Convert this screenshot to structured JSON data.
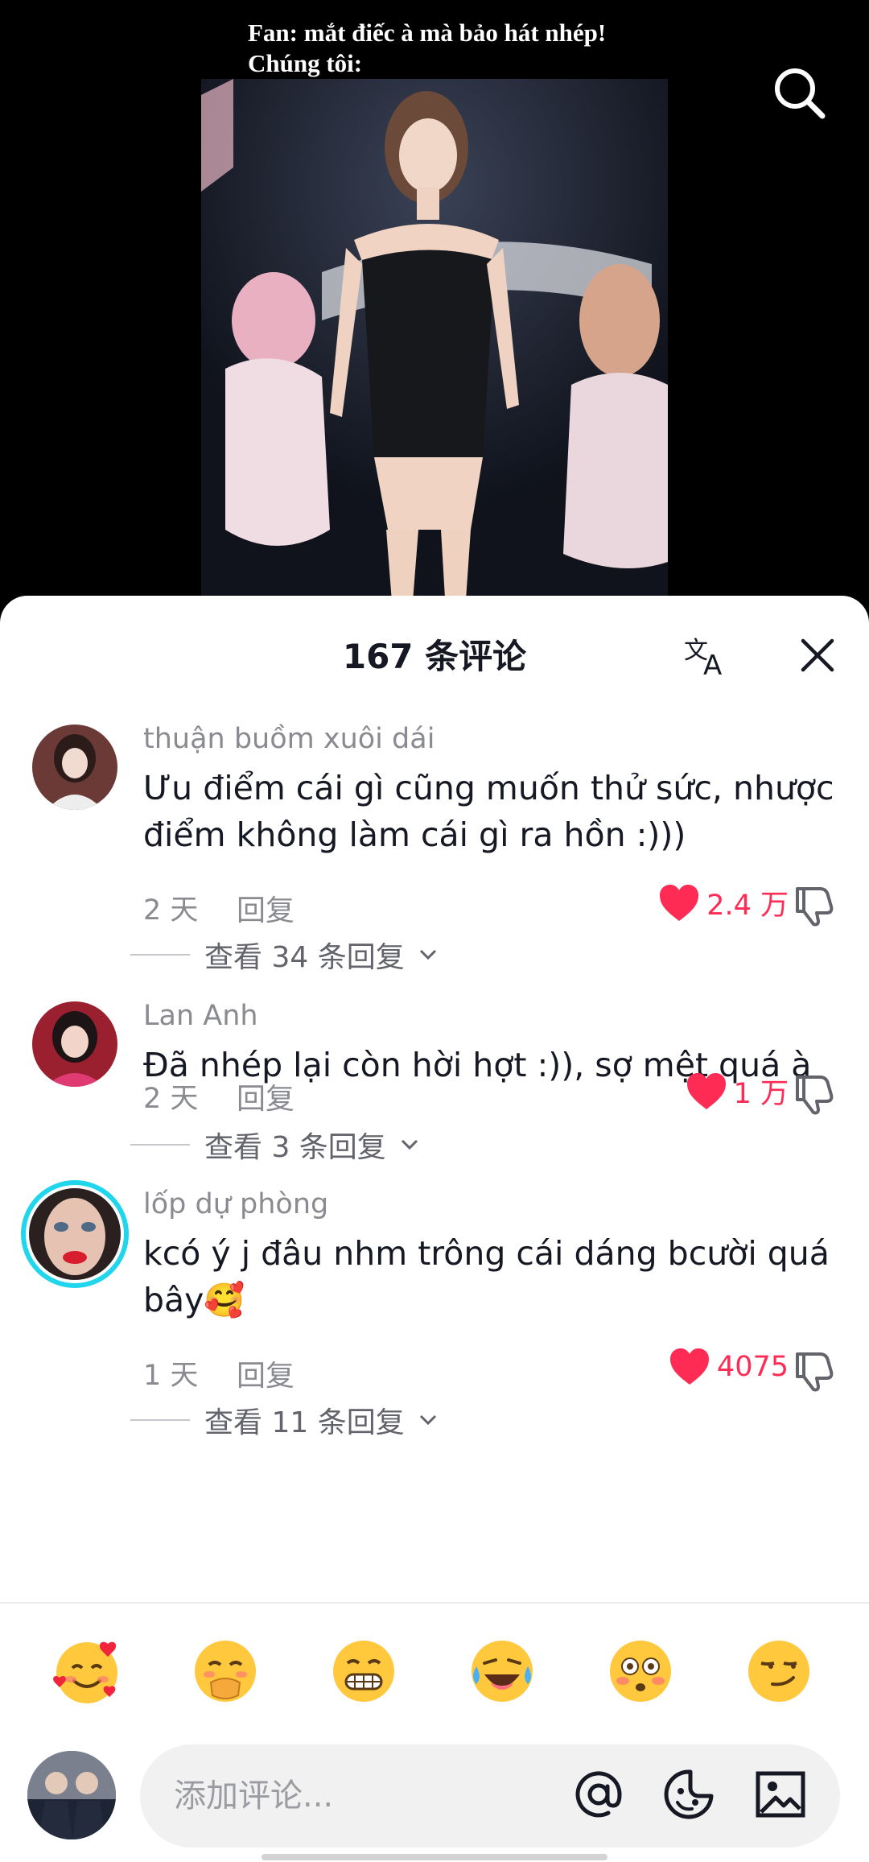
{
  "video": {
    "caption_line1": "Fan: mắt điếc à mà bảo hát nhép!",
    "caption_line2": "Chúng tôi:",
    "search_icon": "search-icon"
  },
  "sheet": {
    "title": "167 条评论",
    "translate_icon": "translate-icon",
    "close_icon": "close-icon"
  },
  "comments": [
    {
      "username": "thuận buồm xuôi dái",
      "text": "Ưu điểm cái gì cũng muốn thử sức, nhược điểm không làm cái gì ra hồn :)))",
      "time": "2 天",
      "reply_label": "回复",
      "likes": "2.4 万",
      "view_replies": "查看 34 条回复"
    },
    {
      "username": "Lan Anh",
      "text": "Đã nhép lại còn hời hợt :)), sợ mệt quá à",
      "time": "2 天",
      "reply_label": "回复",
      "likes": "1 万",
      "view_replies": "查看 3 条回复"
    },
    {
      "username": "lốp dự phòng",
      "text": "kcó ý j đâu nhm trông cái dáng bcười quá bây🥰",
      "time": "1 天",
      "reply_label": "回复",
      "likes": "4075",
      "view_replies": "查看 11 条回复"
    }
  ],
  "quick_emojis": [
    "smiling-face-with-hearts",
    "face-with-hand-over-mouth",
    "grinning-teeth",
    "tears-of-joy",
    "flushed-face",
    "smirking-face"
  ],
  "input": {
    "placeholder": "添加评论...",
    "icons": [
      "mention-icon",
      "emoji-icon",
      "image-icon"
    ]
  },
  "colors": {
    "like_red": "#fe2c55",
    "verified_ring": "#20d5ec",
    "muted_text": "#8a8b91"
  }
}
